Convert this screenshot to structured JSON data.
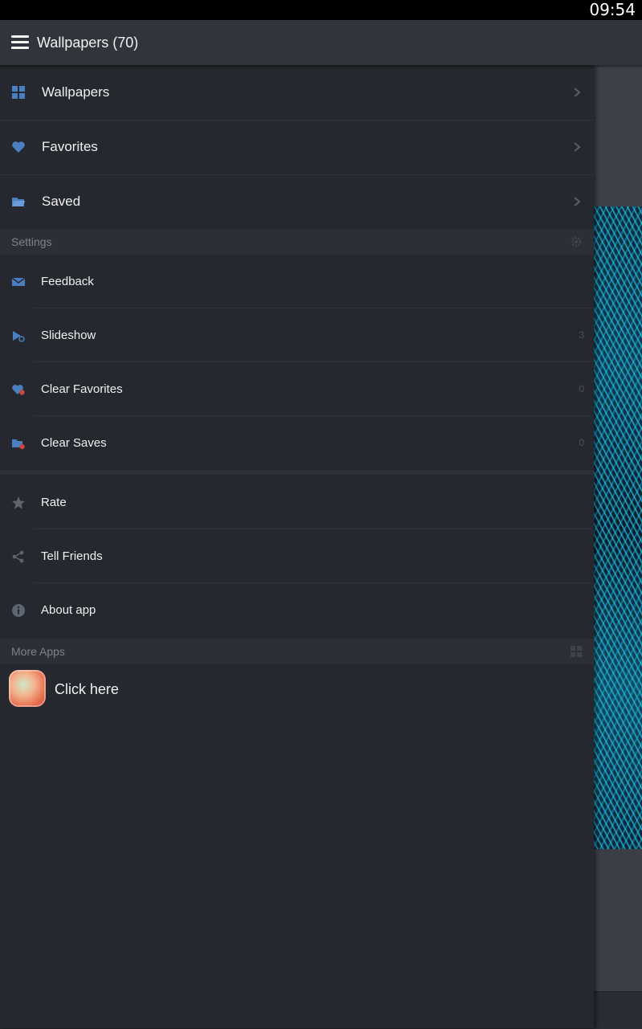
{
  "status_bar": {
    "time": "09:54"
  },
  "app_bar": {
    "title": "Wallpapers (70)"
  },
  "nav": [
    {
      "label": "Wallpapers",
      "icon": "grid-icon"
    },
    {
      "label": "Favorites",
      "icon": "heart-icon"
    },
    {
      "label": "Saved",
      "icon": "folder-icon"
    }
  ],
  "settings": {
    "header": "Settings",
    "items": [
      {
        "label": "Feedback",
        "count": "",
        "icon": "mail-icon"
      },
      {
        "label": "Slideshow",
        "count": "3",
        "icon": "slideshow-icon"
      },
      {
        "label": "Clear Favorites",
        "count": "0",
        "icon": "clear-heart-icon"
      },
      {
        "label": "Clear Saves",
        "count": "0",
        "icon": "clear-folder-icon"
      }
    ]
  },
  "misc": [
    {
      "label": "Rate",
      "icon": "star-icon"
    },
    {
      "label": "Tell Friends",
      "icon": "share-icon"
    },
    {
      "label": "About app",
      "icon": "info-icon"
    }
  ],
  "more_apps": {
    "header": "More Apps",
    "item_label": "Click here"
  },
  "colors": {
    "accent_icon": "#4a7fc1",
    "drawer_bg": "#25282e",
    "app_bar_bg": "#30343b"
  }
}
